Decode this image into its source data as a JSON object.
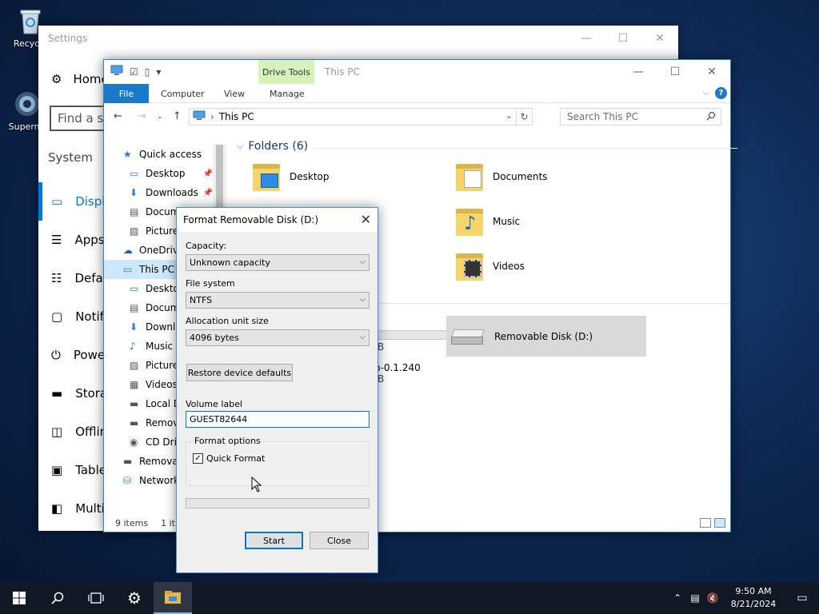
{
  "desktop": {
    "icons": [
      {
        "label": "Recycle",
        "icon": "recycle-bin-icon"
      },
      {
        "label": "Superm",
        "icon": "app-globe-icon"
      }
    ]
  },
  "settings": {
    "title": "Settings",
    "home_label": "Home",
    "search_placeholder": "Find a se",
    "section_label": "System",
    "nav": [
      {
        "label": "Displa",
        "icon": "display-icon",
        "selected": true
      },
      {
        "label": "Apps",
        "icon": "apps-list-icon",
        "selected": false
      },
      {
        "label": "Defau",
        "icon": "defaults-icon",
        "selected": false
      },
      {
        "label": "Notif",
        "icon": "notifications-icon",
        "selected": false
      },
      {
        "label": "Powe",
        "icon": "power-icon",
        "selected": false
      },
      {
        "label": "Stora",
        "icon": "storage-icon",
        "selected": false
      },
      {
        "label": "Offlin",
        "icon": "offline-maps-icon",
        "selected": false
      },
      {
        "label": "Table",
        "icon": "tablet-icon",
        "selected": false
      },
      {
        "label": "Multi",
        "icon": "multitasking-icon",
        "selected": false
      }
    ]
  },
  "explorer": {
    "window_title": "This PC",
    "context_tab": "Drive Tools",
    "ribbon_tabs": {
      "file": "File",
      "computer": "Computer",
      "view": "View",
      "manage": "Manage"
    },
    "address": {
      "crumb": "This PC"
    },
    "search_placeholder": "Search This PC",
    "nav_pane": [
      {
        "label": "Quick access",
        "icon": "star-icon",
        "indent": 0,
        "pinned": false
      },
      {
        "label": "Desktop",
        "icon": "desktop-folder-icon",
        "indent": 1,
        "pinned": true
      },
      {
        "label": "Downloads",
        "icon": "download-arrow-icon",
        "indent": 1,
        "pinned": true
      },
      {
        "label": "Docum",
        "icon": "document-icon",
        "indent": 1,
        "pinned": false
      },
      {
        "label": "Picture",
        "icon": "pictures-icon",
        "indent": 1,
        "pinned": false
      },
      {
        "label": "OneDrive",
        "icon": "cloud-icon",
        "indent": 0,
        "pinned": false
      },
      {
        "label": "This PC",
        "icon": "computer-icon",
        "indent": 0,
        "pinned": false,
        "selected": true
      },
      {
        "label": "Deskto",
        "icon": "desktop-folder-icon",
        "indent": 1,
        "pinned": false
      },
      {
        "label": "Docum",
        "icon": "document-icon",
        "indent": 1,
        "pinned": false
      },
      {
        "label": "Downlo",
        "icon": "download-arrow-icon",
        "indent": 1,
        "pinned": false
      },
      {
        "label": "Music",
        "icon": "music-note-icon",
        "indent": 1,
        "pinned": false
      },
      {
        "label": "Picture",
        "icon": "pictures-icon",
        "indent": 1,
        "pinned": false
      },
      {
        "label": "Videos",
        "icon": "video-film-icon",
        "indent": 1,
        "pinned": false
      },
      {
        "label": "Local D",
        "icon": "local-disk-icon",
        "indent": 1,
        "pinned": false
      },
      {
        "label": "Remov",
        "icon": "removable-drive-icon",
        "indent": 1,
        "pinned": false
      },
      {
        "label": "CD Driv",
        "icon": "cd-drive-icon",
        "indent": 1,
        "pinned": false
      },
      {
        "label": "Removal",
        "icon": "removable-drive-icon",
        "indent": 0,
        "pinned": false
      },
      {
        "label": "Network",
        "icon": "network-icon",
        "indent": 0,
        "pinned": false
      }
    ],
    "folders_group": "Folders (6)",
    "folders": [
      {
        "label": "Desktop",
        "badge": "desktop-icon"
      },
      {
        "label": "Documents",
        "badge": "document-icon"
      },
      {
        "label": "Music",
        "badge": "music-note-icon"
      },
      {
        "label": "Videos",
        "badge": "video-film-icon"
      }
    ],
    "drive_fragments": [
      "B",
      "n-0.1.240",
      "B"
    ],
    "removable_disk": "Removable Disk (D:)",
    "status": {
      "items": "9 items",
      "selected": "1 it"
    }
  },
  "format_dialog": {
    "title": "Format Removable Disk (D:)",
    "capacity_label": "Capacity:",
    "capacity_value": "Unknown capacity",
    "fs_label": "File system",
    "fs_value": "NTFS",
    "alloc_label": "Allocation unit size",
    "alloc_value": "4096 bytes",
    "restore_button": "Restore device defaults",
    "volume_label_label": "Volume label",
    "volume_label_value": "GUEST82644",
    "options_group": "Format options",
    "quick_format_label": "Quick Format",
    "quick_format_checked": true,
    "progress": 0,
    "start_button": "Start",
    "close_button": "Close"
  },
  "taskbar": {
    "time": "9:50 AM",
    "date": "8/21/2024",
    "items": [
      "start-windows-icon",
      "search-icon",
      "task-view-icon",
      "settings-gear-icon",
      "file-explorer-icon"
    ]
  },
  "colors": {
    "accent": "#0078d7",
    "ribbon_file": "#1979ca",
    "context_tab": "#d6f2b8",
    "folder": "#f6d56b",
    "selection": "#cce8ff"
  }
}
